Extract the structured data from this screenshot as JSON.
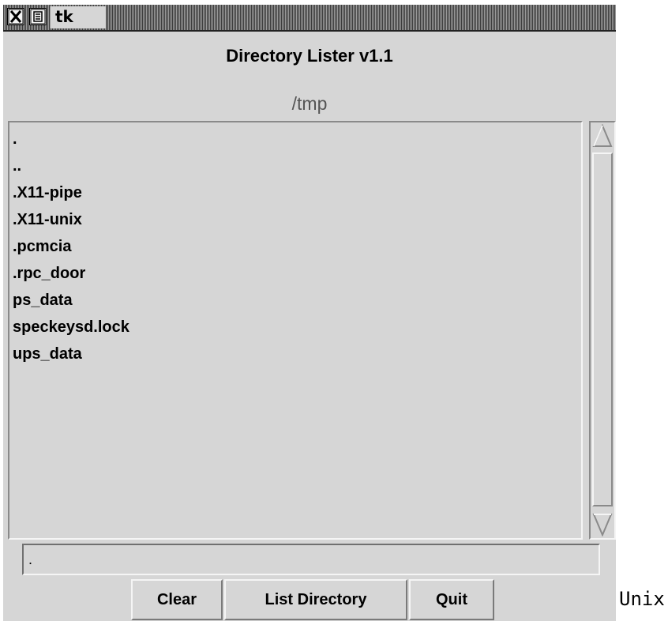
{
  "window": {
    "title": "tk",
    "close_icon": "close-x-icon",
    "menu_icon": "window-menu-icon"
  },
  "app": {
    "heading": "Directory Lister v1.1",
    "path": "/tmp"
  },
  "listing": {
    "items": [
      ".",
      "..",
      ".X11-pipe",
      ".X11-unix",
      ".pcmcia",
      ".rpc_door",
      "ps_data",
      "speckeysd.lock",
      "ups_data"
    ]
  },
  "entry": {
    "value": "."
  },
  "buttons": {
    "clear": "Clear",
    "list_directory": "List Directory",
    "quit": "Quit"
  },
  "caption": "Unix"
}
